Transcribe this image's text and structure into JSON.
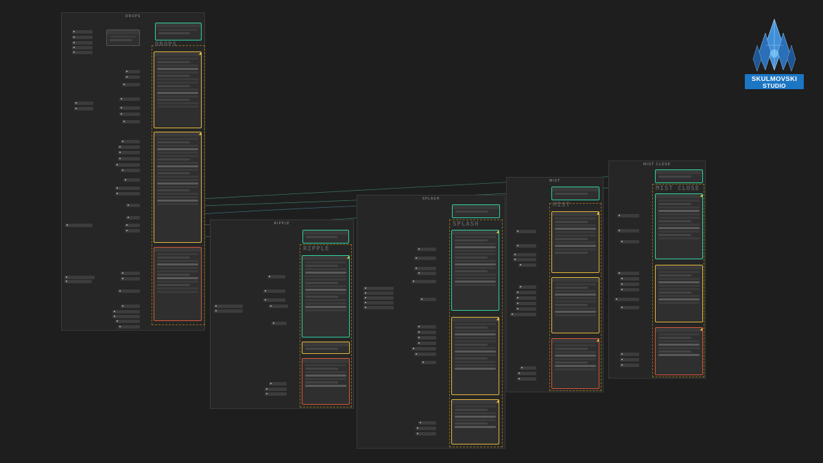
{
  "groups": {
    "drops": "DROPS",
    "ripple": "RIPPLE",
    "splash": "SPLASH",
    "mist": "MIST",
    "mist_close": "MIST CLOSE"
  },
  "logo": {
    "line1": "SKULMOVSKI",
    "line2": "STUDIO",
    "brand_color": "#1b76c4"
  },
  "canvas_labels": {
    "drops": "DROPS",
    "ripple": "RIPPLE",
    "splash": "SPLASH",
    "mist": "MIST",
    "mist_close": "MIST CLOSE"
  },
  "colors": {
    "background": "#1e1e1e",
    "group": "#262626",
    "node": "#2f2f2f",
    "yellow": "#e8b93c",
    "teal": "#2fd6a4",
    "red": "#d9563a"
  }
}
